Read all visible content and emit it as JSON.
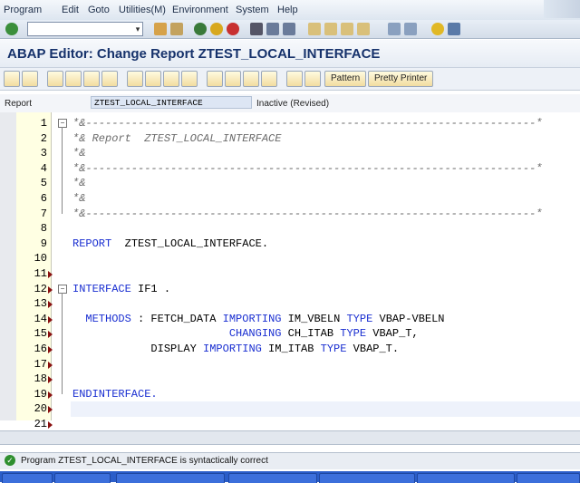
{
  "menu": [
    "Program",
    "Edit",
    "Goto",
    "Utilities(M)",
    "Environment",
    "System",
    "Help"
  ],
  "menu_underline": [
    "P",
    "E",
    "G",
    "U",
    "n",
    "S",
    "H"
  ],
  "window_title": "ABAP Editor: Change Report ZTEST_LOCAL_INTERFACE",
  "toolbar_buttons": {
    "pattern": "Pattern",
    "pretty_printer": "Pretty Printer"
  },
  "header": {
    "label": "Report",
    "value": "ZTEST_LOCAL_INTERFACE",
    "status": "Inactive (Revised)"
  },
  "code_lines": [
    {
      "n": "1",
      "text": "*&---------------------------------------------------------------------*",
      "type": "comment",
      "fold": "minus",
      "mark": false
    },
    {
      "n": "2",
      "text": "*& Report  ZTEST_LOCAL_INTERFACE",
      "type": "comment",
      "fold": "",
      "mark": false
    },
    {
      "n": "3",
      "text": "*&",
      "type": "comment",
      "fold": "",
      "mark": false
    },
    {
      "n": "4",
      "text": "*&---------------------------------------------------------------------*",
      "type": "comment",
      "fold": "",
      "mark": false
    },
    {
      "n": "5",
      "text": "*&",
      "type": "comment",
      "fold": "",
      "mark": false
    },
    {
      "n": "6",
      "text": "*&",
      "type": "comment",
      "fold": "",
      "mark": false
    },
    {
      "n": "7",
      "text": "*&---------------------------------------------------------------------*",
      "type": "comment",
      "fold": "end",
      "mark": false
    },
    {
      "n": "8",
      "text": "",
      "type": "plain",
      "fold": "",
      "mark": false
    },
    {
      "n": "9",
      "text": "REPORT  ZTEST_LOCAL_INTERFACE.",
      "type": "report",
      "fold": "",
      "mark": false
    },
    {
      "n": "10",
      "text": "",
      "type": "plain",
      "fold": "",
      "mark": false
    },
    {
      "n": "11",
      "text": "",
      "type": "plain",
      "fold": "",
      "mark": true
    },
    {
      "n": "12",
      "text": "INTERFACE IF1 .",
      "type": "interface",
      "fold": "minus",
      "mark": true
    },
    {
      "n": "13",
      "text": "",
      "type": "plain",
      "fold": "",
      "mark": true
    },
    {
      "n": "14",
      "text": "  METHODS : FETCH_DATA IMPORTING IM_VBELN TYPE VBAP-VBELN",
      "type": "methods1",
      "fold": "",
      "mark": true
    },
    {
      "n": "15",
      "text": "                        CHANGING CH_ITAB TYPE VBAP_T,",
      "type": "methods2",
      "fold": "",
      "mark": true
    },
    {
      "n": "16",
      "text": "            DISPLAY IMPORTING IM_ITAB TYPE VBAP_T.",
      "type": "methods3",
      "fold": "",
      "mark": true
    },
    {
      "n": "17",
      "text": "",
      "type": "plain",
      "fold": "",
      "mark": true
    },
    {
      "n": "18",
      "text": "",
      "type": "plain",
      "fold": "",
      "mark": true
    },
    {
      "n": "19",
      "text": "ENDINTERFACE.",
      "type": "endinterface",
      "fold": "end",
      "mark": true
    },
    {
      "n": "20",
      "text": "",
      "type": "plain",
      "fold": "",
      "mark": true
    },
    {
      "n": "21",
      "text": "",
      "type": "plain",
      "fold": "",
      "mark": true
    }
  ],
  "status_message": "Program ZTEST_LOCAL_INTERFACE is syntactically correct",
  "colors": {
    "keyword": "#1a2fd1",
    "comment": "#6b6b6b",
    "title": "#16326b",
    "gutter": "#ffffe3"
  }
}
